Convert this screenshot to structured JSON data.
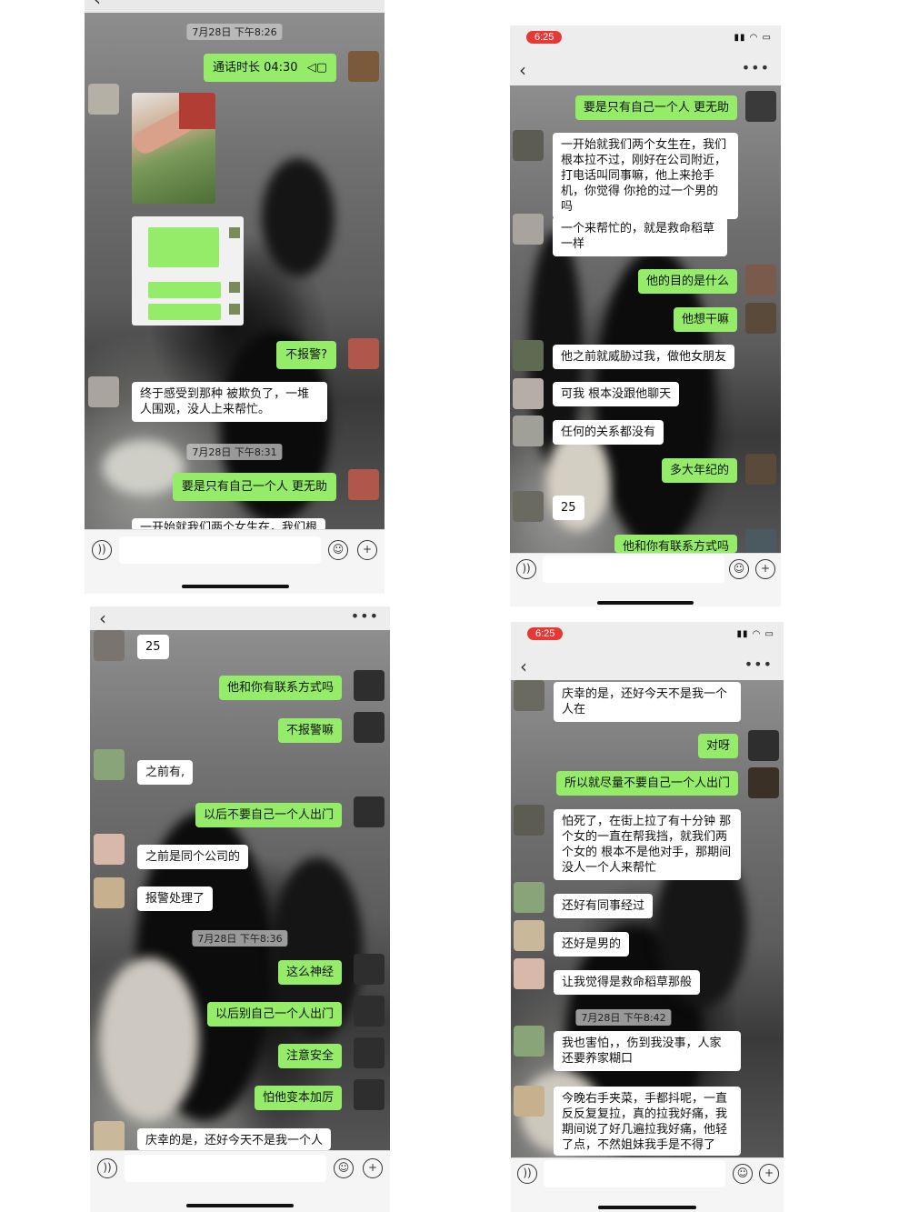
{
  "screens": [
    {
      "status_time": "",
      "title": "",
      "messages": [
        {
          "kind": "time",
          "text": "7月28日 下午8:26"
        },
        {
          "kind": "me",
          "text": "通话时长 04:30"
        },
        {
          "kind": "me",
          "text": "不报警?"
        },
        {
          "kind": "them",
          "text": "终于感受到那种 被欺负了，一堆人围观，没人上来帮忙。"
        },
        {
          "kind": "time",
          "text": "7月28日 下午8:31"
        },
        {
          "kind": "me",
          "text": "要是只有自己一个人 更无助"
        },
        {
          "kind": "them",
          "text": "一开始就我们两个女生在，我们根"
        }
      ]
    },
    {
      "status_time": "6:25",
      "title": "",
      "messages": [
        {
          "kind": "me",
          "text": "要是只有自己一个人 更无助"
        },
        {
          "kind": "them",
          "text": "一开始就我们两个女生在，我们根本拉不过，刚好在公司附近，打电话叫同事嘛，他上来抢手机，你觉得 你抢的过一个男的吗"
        },
        {
          "kind": "them",
          "text": "一个来帮忙的，就是救命稻草一样"
        },
        {
          "kind": "me",
          "text": "他的目的是什么"
        },
        {
          "kind": "me",
          "text": "他想干嘛"
        },
        {
          "kind": "them",
          "text": "他之前就威胁过我，做他女朋友"
        },
        {
          "kind": "them",
          "text": "可我 根本没跟他聊天"
        },
        {
          "kind": "them",
          "text": "任何的关系都没有"
        },
        {
          "kind": "me",
          "text": "多大年纪的"
        },
        {
          "kind": "them",
          "text": "25"
        },
        {
          "kind": "me",
          "text": "他和你有联系方式吗"
        }
      ]
    },
    {
      "status_time": "",
      "title": "",
      "messages": [
        {
          "kind": "them",
          "text": "25"
        },
        {
          "kind": "me",
          "text": "他和你有联系方式吗"
        },
        {
          "kind": "me",
          "text": "不报警嘛"
        },
        {
          "kind": "them",
          "text": "之前有,"
        },
        {
          "kind": "me",
          "text": "以后不要自己一个人出门"
        },
        {
          "kind": "them",
          "text": "之前是同个公司的"
        },
        {
          "kind": "them",
          "text": "报警处理了"
        },
        {
          "kind": "time",
          "text": "7月28日 下午8:36"
        },
        {
          "kind": "me",
          "text": "这么神经"
        },
        {
          "kind": "me",
          "text": "以后别自己一个人出门"
        },
        {
          "kind": "me",
          "text": "注意安全"
        },
        {
          "kind": "me",
          "text": "怕他变本加厉"
        },
        {
          "kind": "them",
          "text": "庆幸的是，还好今天不是我一个人"
        }
      ]
    },
    {
      "status_time": "6:25",
      "title": "",
      "messages": [
        {
          "kind": "them",
          "text": "庆幸的是，还好今天不是我一个人在"
        },
        {
          "kind": "me",
          "text": "对呀"
        },
        {
          "kind": "me",
          "text": "所以就尽量不要自己一个人出门"
        },
        {
          "kind": "them",
          "text": "怕死了，在街上拉了有十分钟 那个女的一直在帮我挡，就我们两个女的 根本不是他对手，那期间没人一个人来帮忙"
        },
        {
          "kind": "them",
          "text": "还好有同事经过"
        },
        {
          "kind": "them",
          "text": "还好是男的"
        },
        {
          "kind": "them",
          "text": "让我觉得是救命稻草那般"
        },
        {
          "kind": "time",
          "text": "7月28日 下午8:42"
        },
        {
          "kind": "them",
          "text": "我也害怕，，伤到我没事，人家还要养家糊口"
        },
        {
          "kind": "them",
          "text": "今晚右手夹菜，手都抖呢，一直反反复复拉，真的拉我好痛，我期间说了好几遍拉我好痛，他轻了点，不然姐妹我手是不得了"
        }
      ]
    }
  ]
}
